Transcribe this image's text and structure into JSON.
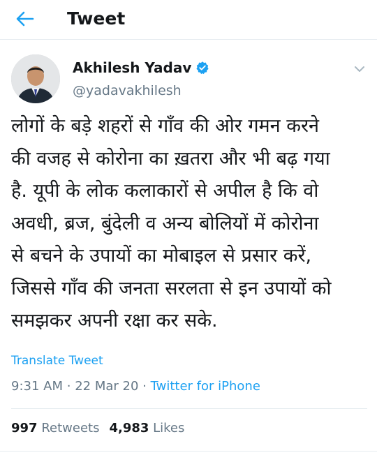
{
  "header": {
    "title": "Tweet",
    "back_icon": "arrow-left-icon"
  },
  "author": {
    "name": "Akhilesh Yadav",
    "handle": "@yadavakhilesh",
    "verified": true,
    "verified_icon": "verified-badge-icon"
  },
  "tweet": {
    "text": "लोगों के बड़े शहरों से गाँव की ओर गमन करने\nकी वजह से कोरोना का ख़तरा और भी बढ़ गया\nहै. यूपी के लोक कलाकारों से अपील है कि वो\nअवधी, ब्रज, बुंदेली व अन्य बोलियों में कोरोना\nसे बचने के उपायों का मोबाइल से प्रसार करें,\nजिससे गाँव की जनता सरलता से इन उपायों को\nसमझकर अपनी रक्षा कर सके.",
    "translate_label": "Translate Tweet",
    "time": "9:31 AM",
    "date": "22 Mar 20",
    "source": "Twitter for iPhone",
    "separator": "·"
  },
  "stats": {
    "retweets_count": "997",
    "retweets_label": "Retweets",
    "likes_count": "4,983",
    "likes_label": "Likes"
  },
  "colors": {
    "accent": "#1da1f2",
    "muted": "#657786",
    "text": "#14171a"
  }
}
